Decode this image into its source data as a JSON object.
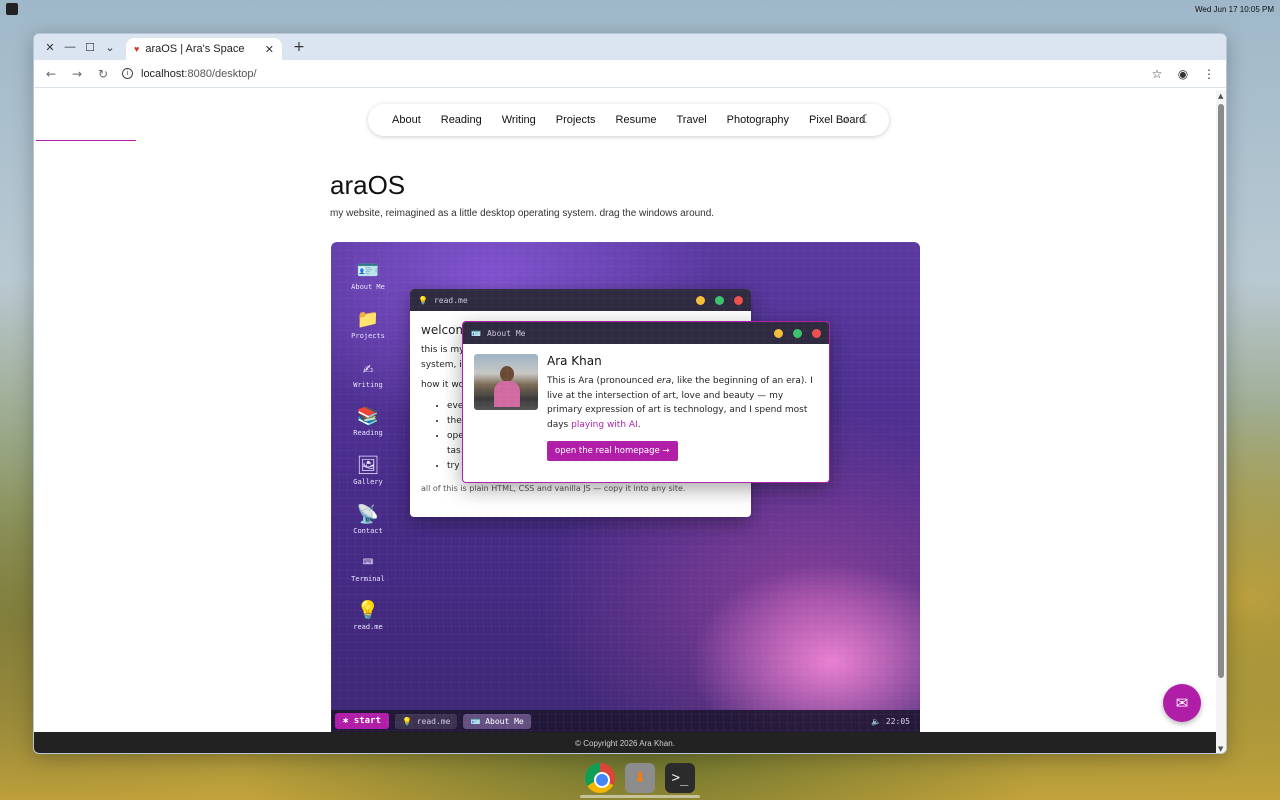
{
  "system": {
    "clock": "Wed Jun 17  10:05 PM"
  },
  "browser": {
    "tab_title": "araOS | Ara's Space",
    "url_host": "localhost",
    "url_path": ":8080/desktop/"
  },
  "site": {
    "nav": [
      "About",
      "Reading",
      "Writing",
      "Projects",
      "Resume",
      "Travel",
      "Photography",
      "Pixel Board"
    ],
    "title": "araOS",
    "subtitle": "my website, reimagined as a little desktop operating system. drag the windows around.",
    "footer": "© Copyright 2026 Ara Khan."
  },
  "os": {
    "icons": [
      {
        "label": "About Me",
        "icon": "id-card-icon",
        "glyph": "🪪"
      },
      {
        "label": "Projects",
        "icon": "folder-icon",
        "glyph": "📁"
      },
      {
        "label": "Writing",
        "icon": "writing-hand-icon",
        "glyph": "✍"
      },
      {
        "label": "Reading",
        "icon": "books-icon",
        "glyph": "📚"
      },
      {
        "label": "Gallery",
        "icon": "picture-icon",
        "glyph": "🖼"
      },
      {
        "label": "Contact",
        "icon": "satellite-icon",
        "glyph": "📡"
      },
      {
        "label": "Terminal",
        "icon": "keyboard-icon",
        "glyph": "⌨"
      },
      {
        "label": "read.me",
        "icon": "lightbulb-icon",
        "glyph": "💡"
      }
    ],
    "readme": {
      "title": "read.me",
      "heading": "welcom",
      "line1": "this is my",
      "line2": "system, i",
      "how": "how it wo",
      "bullets": [
        "eve",
        "the",
        "ope",
        "tas",
        "try"
      ],
      "footnote": "all of this is plain HTML, CSS and vanilla JS — copy it into any site."
    },
    "about": {
      "title": "About Me",
      "name": "Ara Khan",
      "text_a": "This is Ara (pronounced ",
      "text_em": "era",
      "text_b": ", like the beginning of an era). I live at the intersection of art, love and beauty — my primary expression of art is technology, and I spend most days ",
      "link": "playing with AI",
      "text_c": ".",
      "cta": "open the real homepage →"
    },
    "taskbar": {
      "start": "start",
      "items": [
        "read.me",
        "About Me"
      ],
      "clock": "22:05"
    }
  },
  "colors": {
    "accent": "#b01ea8"
  }
}
